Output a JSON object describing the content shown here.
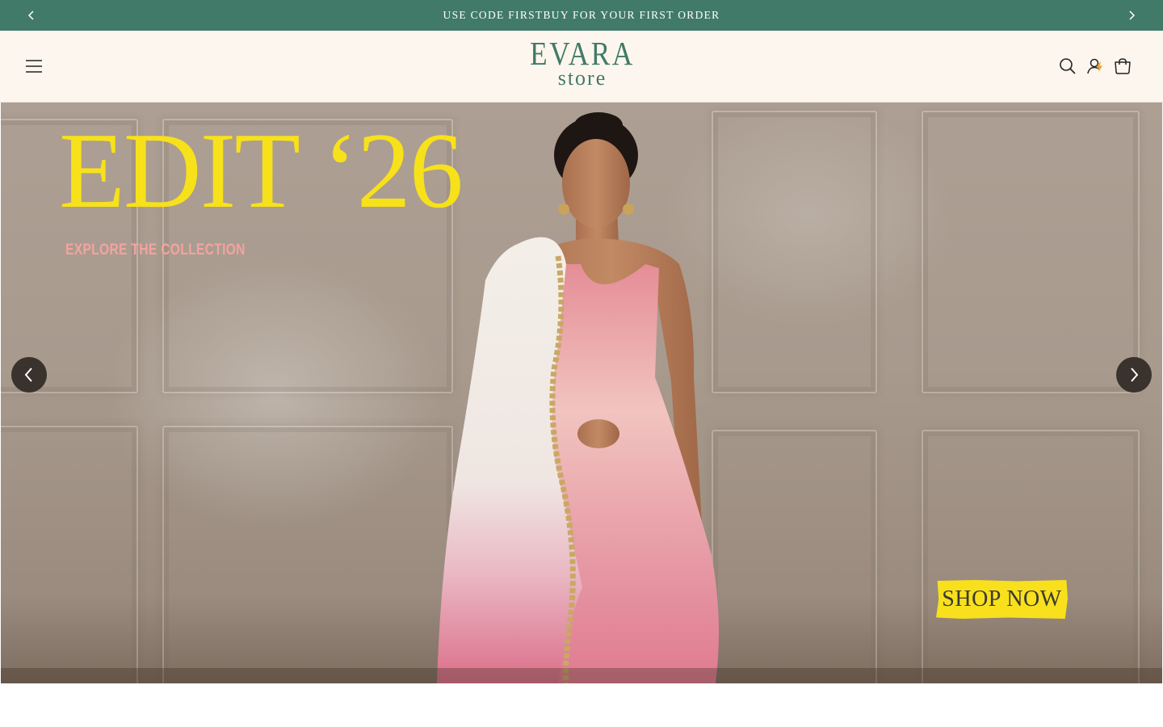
{
  "announcement": {
    "text": "USE CODE FIRSTBUY FOR YOUR FIRST ORDER",
    "prev_icon": "chevron-left-icon",
    "next_icon": "chevron-right-icon",
    "background": "#417a68"
  },
  "header": {
    "logo_top": "EVARA",
    "logo_bottom": "store",
    "menu_icon": "hamburger-menu-icon",
    "search_icon": "search-icon",
    "account_icon": "account-icon",
    "cart_icon": "cart-icon",
    "background": "#fdf6ee",
    "brand_color": "#417a68"
  },
  "hero": {
    "title": "EDIT ‘26",
    "subtitle": "EXPLORE THE COLLECTION",
    "cta_label": "SHOP NOW",
    "title_color": "#f7e11a",
    "subtitle_color": "#f4a3a0",
    "cta_color": "#f8e01c",
    "prev_icon": "chevron-left-icon",
    "next_icon": "chevron-right-icon"
  }
}
